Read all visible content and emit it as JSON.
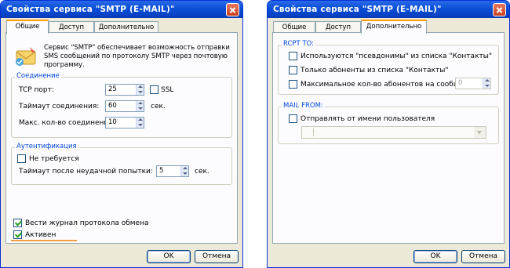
{
  "left_window": {
    "title": "Свойства сервиса \"SMTP (E-MAIL)\"",
    "tabs": [
      {
        "label": "Общие",
        "active": true
      },
      {
        "label": "Доступ",
        "active": false
      },
      {
        "label": "Дополнительно",
        "active": false
      }
    ],
    "icon": "envelope-icon",
    "description": "Сервис \"SMTP\" обеспечивает возможность отправки SMS сообщений по протоколу SMTP через почтовую программу.",
    "connection": {
      "legend": "Соединение",
      "tcp_port_label": "TCP порт:",
      "tcp_port_value": "25",
      "ssl_label": "SSL",
      "ssl_checked": false,
      "timeout_label": "Таймаут соединения:",
      "timeout_value": "60",
      "timeout_unit": "сек.",
      "max_conn_label": "Макс. кол-во соединений:",
      "max_conn_value": "10"
    },
    "auth": {
      "legend": "Аутентификация",
      "not_required_label": "Не требуется",
      "not_required_checked": false,
      "retry_timeout_label": "Таймаут после неудачной попытки:",
      "retry_timeout_value": "5",
      "retry_timeout_unit": "сек."
    },
    "log_label": "Вести журнал протокола обмена",
    "log_checked": true,
    "active_label": "Активен",
    "active_checked": true,
    "ok_label": "OK",
    "cancel_label": "Отмена"
  },
  "right_window": {
    "title": "Свойства сервиса \"SMTP (E-MAIL)\"",
    "tabs": [
      {
        "label": "Общие",
        "active": false
      },
      {
        "label": "Доступ",
        "active": false
      },
      {
        "label": "Дополнительно",
        "active": true
      }
    ],
    "rcpt": {
      "legend": "RCPT TO:",
      "aliases_label": "Используются  \"псевдонимы\" из списка \"Контакты\"",
      "aliases_checked": false,
      "only_contacts_label": "Только абоненты из списка \"Контакты\"",
      "only_contacts_checked": false,
      "max_recipients_label": "Максимальное кол-во абонентов на сообщение:",
      "max_recipients_checked": false,
      "max_recipients_value": "0"
    },
    "mail_from": {
      "legend": "MAIL FROM:",
      "send_as_user_label": "Отправлять от имени пользователя",
      "send_as_user_checked": false,
      "user_select_value": ""
    },
    "ok_label": "OK",
    "cancel_label": "Отмена"
  }
}
